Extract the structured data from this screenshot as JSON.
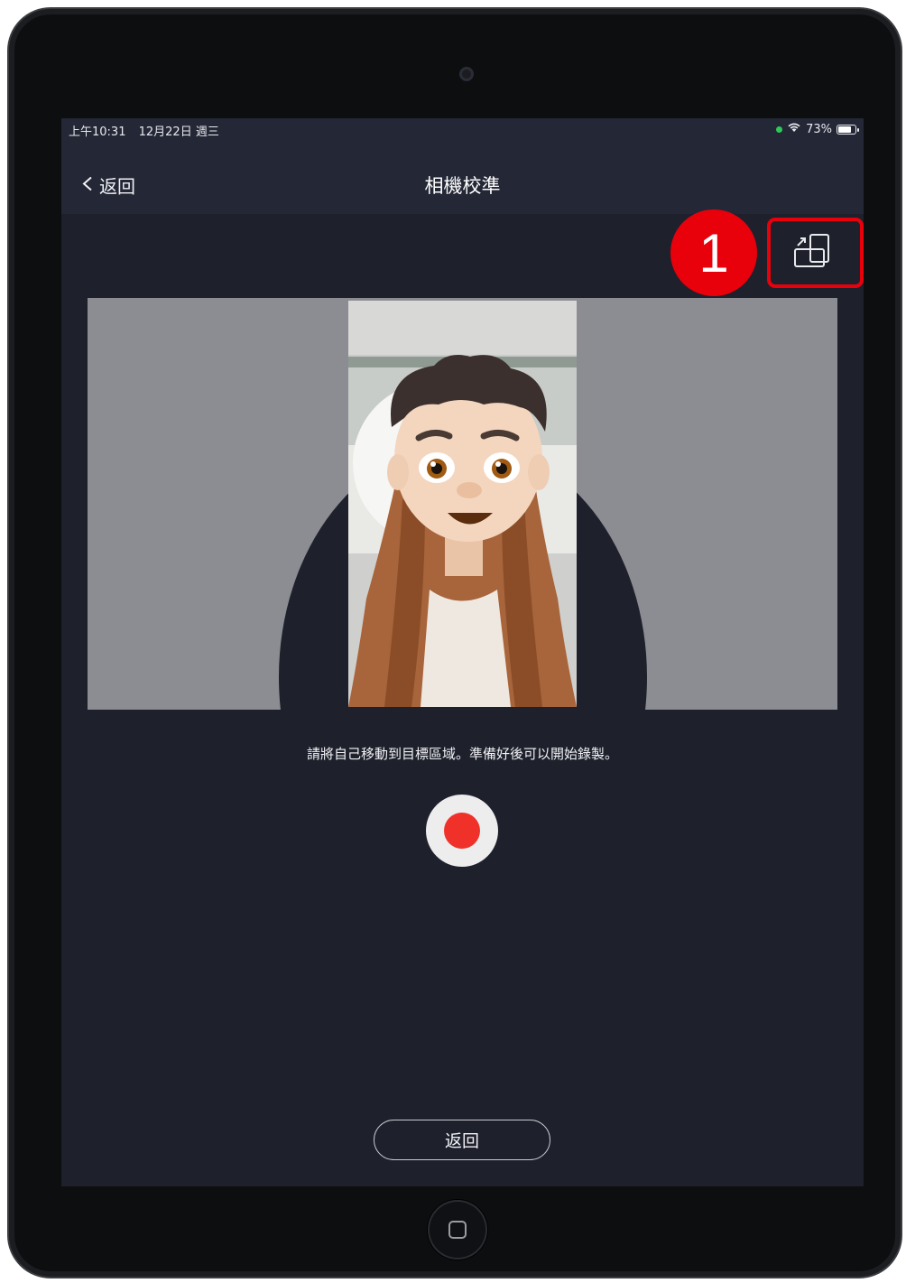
{
  "status_bar": {
    "time": "上午10:31",
    "date": "12月22日 週三",
    "battery": "73%"
  },
  "nav": {
    "back_label": "返回",
    "title": "相機校準"
  },
  "annotation": {
    "step_number": "1",
    "highlight_color": "#e8000b"
  },
  "main": {
    "prompt": "請將自己移動到目標區域。準備好後可以開始錄製。",
    "back_button_label": "返回"
  },
  "icons": {
    "back": "chevron-left-icon",
    "orientation": "rotate-orientation-icon",
    "wifi": "wifi-icon",
    "battery": "battery-icon",
    "record": "record-icon"
  },
  "colors": {
    "background": "#1e202c",
    "header": "#242736",
    "record_red": "#f0312a"
  }
}
